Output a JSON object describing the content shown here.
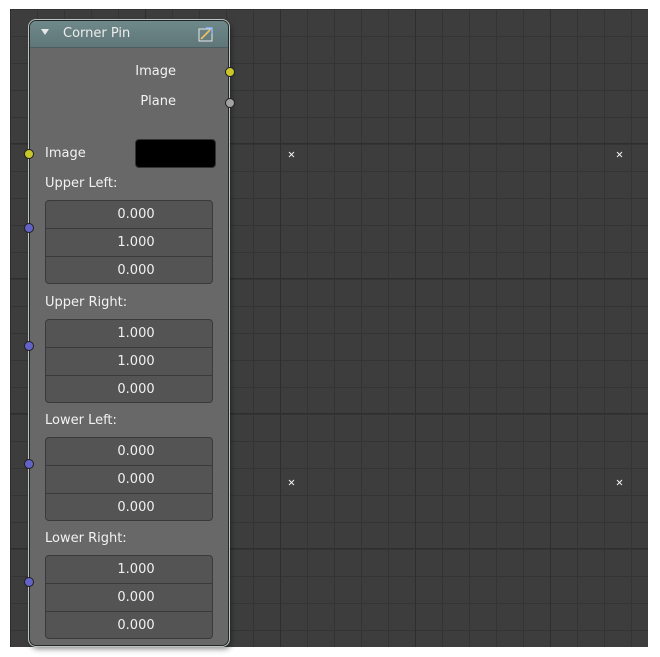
{
  "node": {
    "title": "Corner Pin",
    "header_color": "#6a8285",
    "outputs": [
      {
        "label": "Image",
        "socket_color": "#c7c729"
      },
      {
        "label": "Plane",
        "socket_color": "#a1a1a1"
      }
    ],
    "image_input": {
      "label": "Image",
      "socket_color": "#c7c729",
      "value_color": "#000000"
    },
    "vectors": [
      {
        "label": "Upper Left:",
        "values": [
          "0.000",
          "1.000",
          "0.000"
        ]
      },
      {
        "label": "Upper Right:",
        "values": [
          "1.000",
          "1.000",
          "0.000"
        ]
      },
      {
        "label": "Lower Left:",
        "values": [
          "0.000",
          "0.000",
          "0.000"
        ]
      },
      {
        "label": "Lower Right:",
        "values": [
          "1.000",
          "0.000",
          "0.000"
        ]
      }
    ],
    "vector_socket_color": "#6363c7"
  },
  "icons": {
    "collapse": "triangle-down-icon",
    "preview": "image-preview-icon",
    "markers": "corner-x-marker"
  }
}
